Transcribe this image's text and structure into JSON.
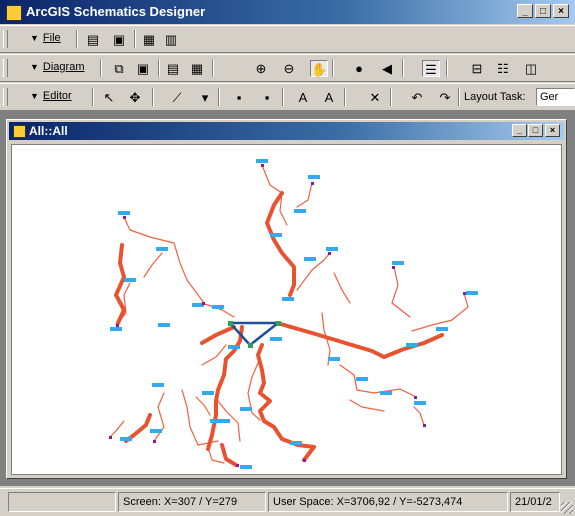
{
  "window": {
    "title": "ArcGIS Schematics Designer",
    "minimize": "_",
    "maximize": "□",
    "close": "×"
  },
  "toolbars": {
    "file": {
      "menu_label": "File"
    },
    "diagram": {
      "menu_label": "Diagram"
    },
    "editor": {
      "menu_label": "Editor",
      "layout_task_label": "Layout Task:",
      "layout_task_value": "Ger"
    }
  },
  "child_window": {
    "title": "All::All"
  },
  "status": {
    "pane1": "",
    "screen": "Screen: X=307 / Y=279",
    "user_space": "User Space: X=3706,92 / Y=-5273,474",
    "date": "21/01/2"
  },
  "colors": {
    "thick_link": "#e8522e",
    "thin_link": "#f06040",
    "node_label": "#33aaee",
    "triangle": "#1f4e9a",
    "node": "#8b1a9a"
  }
}
